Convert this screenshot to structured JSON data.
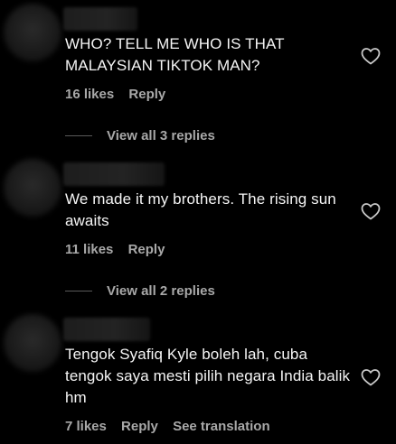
{
  "comments": [
    {
      "text": "WHO? TELL ME WHO IS THAT MALAYSIAN TIKTOK MAN?",
      "likes": "16 likes",
      "reply": "Reply",
      "view_replies": "View all 3 replies"
    },
    {
      "text": "We made it my brothers. The rising sun awaits",
      "likes": "11 likes",
      "reply": "Reply",
      "view_replies": "View all 2 replies"
    },
    {
      "text": "Tengok Syafiq Kyle boleh lah, cuba tengok saya mesti pilih negara India balik hm",
      "likes": "7 likes",
      "reply": "Reply",
      "see_translation": "See translation"
    }
  ],
  "icons": {
    "like": "heart-outline-icon"
  },
  "colors": {
    "background": "#000000",
    "primary_text": "#f5f5f5",
    "secondary_text": "#a8a8a8"
  }
}
